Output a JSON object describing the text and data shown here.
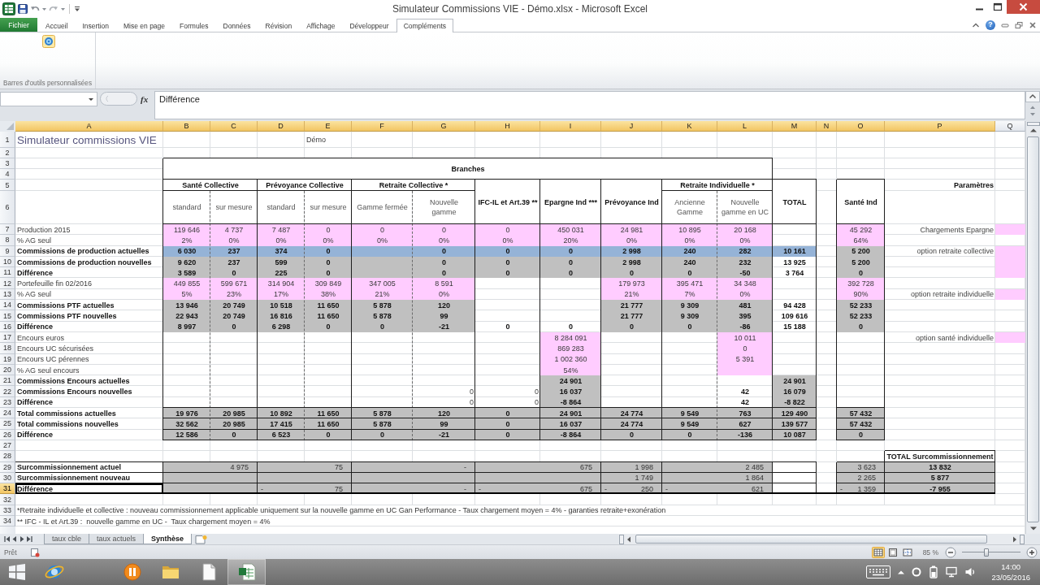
{
  "window": {
    "title": "Simulateur Commissions VIE - Démo.xlsx - Microsoft Excel"
  },
  "ribbon": {
    "file_tab": "Fichier",
    "tabs": [
      {
        "label": "Accueil",
        "selected": false
      },
      {
        "label": "Insertion",
        "selected": false
      },
      {
        "label": "Mise en page",
        "selected": false
      },
      {
        "label": "Formules",
        "selected": false
      },
      {
        "label": "Données",
        "selected": false
      },
      {
        "label": "Révision",
        "selected": false
      },
      {
        "label": "Affichage",
        "selected": false
      },
      {
        "label": "Développeur",
        "selected": false
      },
      {
        "label": "Compléments",
        "selected": true
      }
    ],
    "help": "?",
    "groups": [
      {
        "label": "Barres d'outils personnalisées"
      }
    ]
  },
  "formula_bar": {
    "function_label": "fx",
    "value": "Différence"
  },
  "sheet": {
    "columns": [
      {
        "label": "A",
        "selected": true
      },
      {
        "label": "B",
        "selected": true
      },
      {
        "label": "C",
        "selected": true
      },
      {
        "label": "D",
        "selected": true
      },
      {
        "label": "E",
        "selected": true
      },
      {
        "label": "F",
        "selected": true
      },
      {
        "label": "G",
        "selected": true
      },
      {
        "label": "H",
        "selected": true
      },
      {
        "label": "I",
        "selected": true
      },
      {
        "label": "J",
        "selected": true
      },
      {
        "label": "K",
        "selected": true
      },
      {
        "label": "L",
        "selected": true
      },
      {
        "label": "M",
        "selected": true
      },
      {
        "label": "N",
        "selected": true
      },
      {
        "label": "O",
        "selected": true
      },
      {
        "label": "P",
        "selected": true
      },
      {
        "label": "Q",
        "selected": false
      }
    ],
    "rows": [
      {
        "label": "1",
        "selected": false,
        "cells": {
          "A": {
            "kind": "title",
            "text": "Simulateur commissions VIE"
          },
          "E": {
            "kind": "label",
            "text": "Démo"
          }
        }
      },
      {
        "label": "2",
        "selected": false
      },
      {
        "label": "3",
        "selected": false,
        "cells": {
          "B": {
            "kind": "heading",
            "text": "Branches"
          },
          "C": {
            "kind": "mergeleft"
          },
          "D": {
            "kind": "mergeleft"
          },
          "E": {
            "kind": "mergeleft"
          },
          "F": {
            "kind": "mergeleft"
          },
          "G": {
            "kind": "mergeleft"
          },
          "H": {
            "kind": "mergeleft"
          },
          "I": {
            "kind": "mergeleft"
          },
          "J": {
            "kind": "mergeleft"
          },
          "K": {
            "kind": "mergeleft"
          },
          "L": {
            "kind": "mergeleft"
          }
        }
      },
      {
        "label": "4",
        "selected": false,
        "cells": {
          "B": {
            "kind": "mergeup"
          },
          "C": {
            "kind": "mergeup"
          },
          "D": {
            "kind": "mergeup"
          },
          "E": {
            "kind": "mergeup"
          },
          "F": {
            "kind": "mergeup"
          },
          "G": {
            "kind": "mergeup"
          },
          "H": {
            "kind": "mergeup"
          },
          "I": {
            "kind": "mergeup"
          },
          "J": {
            "kind": "mergeup"
          },
          "K": {
            "kind": "mergeup"
          },
          "L": {
            "kind": "mergeup"
          }
        }
      },
      {
        "label": "5",
        "selected": false,
        "cells": {
          "B": {
            "kind": "heading",
            "text": "Santé Collective"
          },
          "C": {
            "kind": "mergeleft"
          },
          "D": {
            "kind": "heading",
            "text": "Prévoyance Collective"
          },
          "E": {
            "kind": "mergeleft"
          },
          "F": {
            "kind": "heading",
            "text": "Retraite Collective *"
          },
          "G": {
            "kind": "mergeleft"
          },
          "H": {
            "kind": "heading",
            "text": "IFC-IL et Art.39 **"
          },
          "I": {
            "kind": "heading",
            "text": "Epargne Ind ***"
          },
          "J": {
            "kind": "heading",
            "text": "Prévoyance Ind"
          },
          "K": {
            "kind": "heading",
            "text": "Retraite Individuelle *"
          },
          "L": {
            "kind": "mergeleft"
          },
          "M": {
            "kind": "heading",
            "text": "TOTAL"
          },
          "O": {
            "kind": "heading",
            "text": "Santé Ind"
          },
          "P": {
            "kind": "sideheading",
            "text": "Paramètres"
          }
        }
      },
      {
        "label": "6",
        "selected": false,
        "cells": {
          "B": {
            "kind": "caption",
            "text": "standard"
          },
          "C": {
            "kind": "caption",
            "text": "sur mesure"
          },
          "D": {
            "kind": "caption",
            "text": "standard"
          },
          "E": {
            "kind": "caption",
            "text": "sur mesure"
          },
          "F": {
            "kind": "caption",
            "text": "Gamme fermée"
          },
          "G": {
            "kind": "caption",
            "text": "Nouvelle gamme"
          },
          "H": {
            "kind": "mergeup"
          },
          "I": {
            "kind": "mergeup"
          },
          "J": {
            "kind": "mergeup"
          },
          "K": {
            "kind": "caption",
            "text": "Ancienne Gamme"
          },
          "L": {
            "kind": "caption",
            "text": "Nouvelle gamme en UC"
          },
          "M": {
            "kind": "mergeup"
          },
          "O": {
            "kind": "mergeup"
          }
        }
      },
      {
        "label": "7",
        "selected": false,
        "cells": {
          "A": {
            "kind": "label",
            "text": "Production 2015"
          },
          "B": {
            "kind": "input",
            "text": "119 646"
          },
          "C": {
            "kind": "input",
            "text": "4 737"
          },
          "D": {
            "kind": "input",
            "text": "7 487"
          },
          "E": {
            "kind": "input",
            "text": "0"
          },
          "F": {
            "kind": "input",
            "text": "0"
          },
          "G": {
            "kind": "input",
            "text": "0"
          },
          "H": {
            "kind": "input",
            "text": "0"
          },
          "I": {
            "kind": "input",
            "text": "450 031"
          },
          "J": {
            "kind": "input",
            "text": "24 981"
          },
          "K": {
            "kind": "input",
            "text": "10 895"
          },
          "L": {
            "kind": "input",
            "text": "20 168"
          },
          "O": {
            "kind": "input",
            "text": "45 292"
          },
          "P": {
            "kind": "option",
            "text": "Chargements Epargne"
          },
          "Q": {
            "kind": "input"
          }
        }
      },
      {
        "label": "8",
        "selected": false,
        "cells": {
          "A": {
            "kind": "label",
            "text": "% AG seul"
          },
          "B": {
            "kind": "input",
            "text": "2%"
          },
          "C": {
            "kind": "input",
            "text": "0%"
          },
          "D": {
            "kind": "input",
            "text": "0%"
          },
          "E": {
            "kind": "input",
            "text": "0%"
          },
          "F": {
            "kind": "input",
            "text": "0%"
          },
          "G": {
            "kind": "input",
            "text": "0%"
          },
          "H": {
            "kind": "input",
            "text": "0%"
          },
          "I": {
            "kind": "input",
            "text": "20%"
          },
          "J": {
            "kind": "input",
            "text": "0%"
          },
          "K": {
            "kind": "input",
            "text": "0%"
          },
          "L": {
            "kind": "input",
            "text": "0%"
          },
          "O": {
            "kind": "input",
            "text": "64%"
          }
        }
      },
      {
        "label": "9",
        "selected": false,
        "cells": {
          "A": {
            "kind": "boldlabel",
            "text": "Commissions de production actuelles"
          },
          "B": {
            "kind": "highlight",
            "text": "6 030"
          },
          "C": {
            "kind": "highlight",
            "text": "237"
          },
          "D": {
            "kind": "highlight",
            "text": "374"
          },
          "E": {
            "kind": "highlight",
            "text": "0"
          },
          "F": {
            "kind": "highlight"
          },
          "G": {
            "kind": "highlight",
            "text": "0"
          },
          "H": {
            "kind": "highlight",
            "text": "0"
          },
          "I": {
            "kind": "highlight",
            "text": "0"
          },
          "J": {
            "kind": "highlight",
            "text": "2 998"
          },
          "K": {
            "kind": "highlight",
            "text": "240"
          },
          "L": {
            "kind": "highlight",
            "text": "282"
          },
          "M": {
            "kind": "highlight",
            "text": "10 161"
          },
          "O": {
            "kind": "computed",
            "text": "5 200"
          },
          "P": {
            "kind": "option",
            "text": "option retraite collective"
          },
          "Q": {
            "kind": "input"
          }
        }
      },
      {
        "label": "10",
        "selected": false,
        "cells": {
          "A": {
            "kind": "boldlabel",
            "text": "Commissions de production nouvelles"
          },
          "B": {
            "kind": "computed",
            "text": "9 620"
          },
          "C": {
            "kind": "computed",
            "text": "237"
          },
          "D": {
            "kind": "computed",
            "text": "599"
          },
          "E": {
            "kind": "computed",
            "text": "0"
          },
          "F": {
            "kind": "computed"
          },
          "G": {
            "kind": "computed",
            "text": "0"
          },
          "H": {
            "kind": "computed",
            "text": "0"
          },
          "I": {
            "kind": "computed",
            "text": "0"
          },
          "J": {
            "kind": "computed",
            "text": "2 998"
          },
          "K": {
            "kind": "computed",
            "text": "240"
          },
          "L": {
            "kind": "computed",
            "text": "232"
          },
          "M": {
            "kind": "total",
            "text": "13 925"
          },
          "O": {
            "kind": "computed",
            "text": "5 200"
          },
          "Q": {
            "kind": "mergeup"
          }
        }
      },
      {
        "label": "11",
        "selected": false,
        "cells": {
          "A": {
            "kind": "boldlabel",
            "text": "Différence"
          },
          "B": {
            "kind": "computed",
            "text": "3 589"
          },
          "C": {
            "kind": "computed",
            "text": "0"
          },
          "D": {
            "kind": "computed",
            "text": "225"
          },
          "E": {
            "kind": "computed",
            "text": "0"
          },
          "F": {
            "kind": "computed"
          },
          "G": {
            "kind": "computed",
            "text": "0"
          },
          "H": {
            "kind": "computed",
            "text": "0"
          },
          "I": {
            "kind": "computed",
            "text": "0"
          },
          "J": {
            "kind": "computed",
            "text": "0"
          },
          "K": {
            "kind": "computed",
            "text": "0"
          },
          "L": {
            "kind": "computed",
            "text": "-50"
          },
          "M": {
            "kind": "total",
            "text": "3 764"
          },
          "O": {
            "kind": "computed",
            "text": "0"
          },
          "Q": {
            "kind": "mergeup"
          }
        }
      },
      {
        "label": "12",
        "selected": false,
        "cells": {
          "A": {
            "kind": "label",
            "text": "Portefeuille fin 02/2016"
          },
          "B": {
            "kind": "input",
            "text": "449 855"
          },
          "C": {
            "kind": "input",
            "text": "599 671"
          },
          "D": {
            "kind": "input",
            "text": "314 904"
          },
          "E": {
            "kind": "input",
            "text": "309 849"
          },
          "F": {
            "kind": "input",
            "text": "347 005"
          },
          "G": {
            "kind": "input",
            "text": "8 591"
          },
          "J": {
            "kind": "input",
            "text": "179 973"
          },
          "K": {
            "kind": "input",
            "text": "395 471"
          },
          "L": {
            "kind": "input",
            "text": "34 348"
          },
          "O": {
            "kind": "input",
            "text": "392 728"
          }
        }
      },
      {
        "label": "13",
        "selected": false,
        "cells": {
          "A": {
            "kind": "label",
            "text": "% AG seul"
          },
          "B": {
            "kind": "input",
            "text": "5%"
          },
          "C": {
            "kind": "input",
            "text": "23%"
          },
          "D": {
            "kind": "input",
            "text": "17%"
          },
          "E": {
            "kind": "input",
            "text": "38%"
          },
          "F": {
            "kind": "input",
            "text": "21%"
          },
          "G": {
            "kind": "input",
            "text": "0%"
          },
          "J": {
            "kind": "input",
            "text": "21%"
          },
          "K": {
            "kind": "input",
            "text": "7%"
          },
          "L": {
            "kind": "input",
            "text": "0%"
          },
          "O": {
            "kind": "input",
            "text": "90%"
          },
          "P": {
            "kind": "option",
            "text": "option retraite individuelle"
          },
          "Q": {
            "kind": "input"
          }
        }
      },
      {
        "label": "14",
        "selected": false,
        "cells": {
          "A": {
            "kind": "boldlabel",
            "text": "Commissions PTF actuelles"
          },
          "B": {
            "kind": "computed",
            "text": "13 946"
          },
          "C": {
            "kind": "computed",
            "text": "20 749"
          },
          "D": {
            "kind": "computed",
            "text": "10 518"
          },
          "E": {
            "kind": "computed",
            "text": "11 650"
          },
          "F": {
            "kind": "computed",
            "text": "5 878"
          },
          "G": {
            "kind": "computed",
            "text": "120"
          },
          "J": {
            "kind": "computed",
            "text": "21 777"
          },
          "K": {
            "kind": "computed",
            "text": "9 309"
          },
          "L": {
            "kind": "computed",
            "text": "481"
          },
          "M": {
            "kind": "total",
            "text": "94 428"
          },
          "O": {
            "kind": "computed",
            "text": "52 233"
          }
        }
      },
      {
        "label": "15",
        "selected": false,
        "cells": {
          "A": {
            "kind": "boldlabel",
            "text": "Commissions PTF nouvelles"
          },
          "B": {
            "kind": "computed",
            "text": "22 943"
          },
          "C": {
            "kind": "computed",
            "text": "20 749"
          },
          "D": {
            "kind": "computed",
            "text": "16 816"
          },
          "E": {
            "kind": "computed",
            "text": "11 650"
          },
          "F": {
            "kind": "computed",
            "text": "5 878"
          },
          "G": {
            "kind": "computed",
            "text": "99"
          },
          "J": {
            "kind": "computed",
            "text": "21 777"
          },
          "K": {
            "kind": "computed",
            "text": "9 309"
          },
          "L": {
            "kind": "computed",
            "text": "395"
          },
          "M": {
            "kind": "total",
            "text": "109 616"
          },
          "O": {
            "kind": "computed",
            "text": "52 233"
          }
        }
      },
      {
        "label": "16",
        "selected": false,
        "cells": {
          "A": {
            "kind": "boldlabel",
            "text": "Différence"
          },
          "B": {
            "kind": "computed",
            "text": "8 997"
          },
          "C": {
            "kind": "computed",
            "text": "0"
          },
          "D": {
            "kind": "computed",
            "text": "6 298"
          },
          "E": {
            "kind": "computed",
            "text": "0"
          },
          "F": {
            "kind": "computed",
            "text": "0"
          },
          "G": {
            "kind": "computed",
            "text": "-21"
          },
          "H": {
            "kind": "total",
            "text": "0"
          },
          "I": {
            "kind": "total",
            "text": "0"
          },
          "J": {
            "kind": "computed",
            "text": "0"
          },
          "K": {
            "kind": "computed",
            "text": "0"
          },
          "L": {
            "kind": "computed",
            "text": "-86"
          },
          "M": {
            "kind": "total",
            "text": "15 188"
          },
          "O": {
            "kind": "computed",
            "text": "0"
          }
        }
      },
      {
        "label": "17",
        "selected": false,
        "cells": {
          "A": {
            "kind": "label",
            "text": "Encours euros"
          },
          "I": {
            "kind": "input",
            "text": "8 284 091"
          },
          "L": {
            "kind": "input",
            "text": "10 011"
          },
          "P": {
            "kind": "option",
            "text": "option santé individuelle"
          },
          "Q": {
            "kind": "input"
          }
        }
      },
      {
        "label": "18",
        "selected": false,
        "cells": {
          "A": {
            "kind": "label",
            "text": "Encours UC sécurisées"
          },
          "I": {
            "kind": "input",
            "text": "869 283"
          },
          "L": {
            "kind": "input",
            "text": "0"
          }
        }
      },
      {
        "label": "19",
        "selected": false,
        "cells": {
          "A": {
            "kind": "label",
            "text": "Encours UC pérennes"
          },
          "I": {
            "kind": "input",
            "text": "1 002 360"
          },
          "L": {
            "kind": "input",
            "text": "5 391"
          }
        }
      },
      {
        "label": "20",
        "selected": false,
        "cells": {
          "A": {
            "kind": "label",
            "text": "% AG seul encours"
          },
          "I": {
            "kind": "input",
            "text": "54%"
          },
          "L": {
            "kind": "input"
          }
        }
      },
      {
        "label": "21",
        "selected": false,
        "cells": {
          "A": {
            "kind": "boldlabel",
            "text": "Commissions Encours actuelles"
          },
          "I": {
            "kind": "computed",
            "text": "24 901"
          },
          "M": {
            "kind": "computed",
            "text": "24 901"
          }
        }
      },
      {
        "label": "22",
        "selected": false,
        "cells": {
          "A": {
            "kind": "boldlabel",
            "text": "Commissions Encours nouvelles"
          },
          "G": {
            "kind": "general",
            "text": "0"
          },
          "H": {
            "kind": "general",
            "text": "0"
          },
          "I": {
            "kind": "computed",
            "text": "16 037"
          },
          "L": {
            "kind": "total",
            "text": "42"
          },
          "M": {
            "kind": "computed",
            "text": "16 079"
          }
        }
      },
      {
        "label": "23",
        "selected": false,
        "cells": {
          "A": {
            "kind": "boldlabel",
            "text": "Différence"
          },
          "G": {
            "kind": "general",
            "text": "0"
          },
          "H": {
            "kind": "general",
            "text": "0"
          },
          "I": {
            "kind": "computed",
            "text": "-8 864"
          },
          "L": {
            "kind": "total",
            "text": "42"
          },
          "M": {
            "kind": "computed",
            "text": "-8 822"
          }
        }
      },
      {
        "label": "24",
        "selected": false,
        "cells": {
          "A": {
            "kind": "boldlabel",
            "text": "Total commissions actuelles"
          },
          "B": {
            "kind": "computed",
            "text": "19 976"
          },
          "C": {
            "kind": "computed",
            "text": "20 985"
          },
          "D": {
            "kind": "computed",
            "text": "10 892"
          },
          "E": {
            "kind": "computed",
            "text": "11 650"
          },
          "F": {
            "kind": "computed",
            "text": "5 878"
          },
          "G": {
            "kind": "computed",
            "text": "120"
          },
          "H": {
            "kind": "computed",
            "text": "0"
          },
          "I": {
            "kind": "computed",
            "text": "24 901"
          },
          "J": {
            "kind": "computed",
            "text": "24 774"
          },
          "K": {
            "kind": "computed",
            "text": "9 549"
          },
          "L": {
            "kind": "computed",
            "text": "763"
          },
          "M": {
            "kind": "computed",
            "text": "129 490"
          },
          "O": {
            "kind": "computed",
            "text": "57 432"
          }
        }
      },
      {
        "label": "25",
        "selected": false,
        "cells": {
          "A": {
            "kind": "boldlabel",
            "text": "Total commissions nouvelles"
          },
          "B": {
            "kind": "computed",
            "text": "32 562"
          },
          "C": {
            "kind": "computed",
            "text": "20 985"
          },
          "D": {
            "kind": "computed",
            "text": "17 415"
          },
          "E": {
            "kind": "computed",
            "text": "11 650"
          },
          "F": {
            "kind": "computed",
            "text": "5 878"
          },
          "G": {
            "kind": "computed",
            "text": "99"
          },
          "H": {
            "kind": "computed",
            "text": "0"
          },
          "I": {
            "kind": "computed",
            "text": "16 037"
          },
          "J": {
            "kind": "computed",
            "text": "24 774"
          },
          "K": {
            "kind": "computed",
            "text": "9 549"
          },
          "L": {
            "kind": "computed",
            "text": "627"
          },
          "M": {
            "kind": "computed",
            "text": "139 577"
          },
          "O": {
            "kind": "computed",
            "text": "57 432"
          }
        }
      },
      {
        "label": "26",
        "selected": false,
        "cells": {
          "A": {
            "kind": "boldlabel",
            "text": "Différence"
          },
          "B": {
            "kind": "computed",
            "text": "12 586"
          },
          "C": {
            "kind": "computed",
            "text": "0"
          },
          "D": {
            "kind": "computed",
            "text": "6 523"
          },
          "E": {
            "kind": "computed",
            "text": "0"
          },
          "F": {
            "kind": "computed",
            "text": "0"
          },
          "G": {
            "kind": "computed",
            "text": "-21"
          },
          "H": {
            "kind": "computed",
            "text": "0"
          },
          "I": {
            "kind": "computed",
            "text": "-8 864"
          },
          "J": {
            "kind": "computed",
            "text": "0"
          },
          "K": {
            "kind": "computed",
            "text": "0"
          },
          "L": {
            "kind": "computed",
            "text": "-136"
          },
          "M": {
            "kind": "computed",
            "text": "10 087"
          },
          "O": {
            "kind": "computed",
            "text": "0"
          }
        }
      },
      {
        "label": "27",
        "selected": false
      },
      {
        "label": "28",
        "selected": false,
        "cells": {
          "P": {
            "kind": "heading",
            "text": "TOTAL Surcommissionnement"
          }
        }
      },
      {
        "label": "29",
        "selected": false,
        "cells": {
          "A": {
            "kind": "boldlabel",
            "text": "Surcommissionnement actuel"
          },
          "B": {
            "kind": "amount",
            "text": "4 975"
          },
          "C": {
            "kind": "mergeleft"
          },
          "D": {
            "kind": "amount",
            "text": "75"
          },
          "E": {
            "kind": "mergeleft"
          },
          "F": {
            "kind": "amount",
            "text": "-"
          },
          "G": {
            "kind": "mergeleft"
          },
          "H": {
            "kind": "amount",
            "text": "675"
          },
          "I": {
            "kind": "mergeleft"
          },
          "J": {
            "kind": "amount",
            "text": "1 998"
          },
          "K": {
            "kind": "amount",
            "text": "2 485"
          },
          "L": {
            "kind": "mergeleft"
          },
          "O": {
            "kind": "amount",
            "text": "3 623"
          },
          "P": {
            "kind": "computed",
            "text": "13 832"
          }
        }
      },
      {
        "label": "30",
        "selected": false,
        "cells": {
          "A": {
            "kind": "boldlabel",
            "text": "Surcommissionnement nouveau"
          },
          "B": {
            "kind": "amount"
          },
          "C": {
            "kind": "mergeleft"
          },
          "D": {
            "kind": "amount"
          },
          "E": {
            "kind": "mergeleft"
          },
          "F": {
            "kind": "amount"
          },
          "G": {
            "kind": "mergeleft"
          },
          "H": {
            "kind": "amount"
          },
          "I": {
            "kind": "mergeleft"
          },
          "J": {
            "kind": "amount",
            "text": "1 749"
          },
          "K": {
            "kind": "amount",
            "text": "1 864"
          },
          "L": {
            "kind": "mergeleft"
          },
          "O": {
            "kind": "amount",
            "text": "2 265"
          },
          "P": {
            "kind": "computed",
            "text": "5 877"
          }
        }
      },
      {
        "label": "31",
        "selected": true,
        "cells": {
          "A": {
            "kind": "boldlabel",
            "text": "Différence"
          },
          "B": {
            "kind": "amount"
          },
          "C": {
            "kind": "mergeleft"
          },
          "D": {
            "kind": "amount",
            "sign": "-",
            "text": "75"
          },
          "E": {
            "kind": "mergeleft"
          },
          "F": {
            "kind": "amount",
            "text": "-"
          },
          "G": {
            "kind": "mergeleft"
          },
          "H": {
            "kind": "amount",
            "sign": "-",
            "text": "675"
          },
          "I": {
            "kind": "mergeleft"
          },
          "J": {
            "kind": "amount",
            "sign": "-",
            "text": "250"
          },
          "K": {
            "kind": "amount",
            "sign": "-",
            "text": "621"
          },
          "L": {
            "kind": "mergeleft"
          },
          "O": {
            "kind": "amount",
            "sign": "-",
            "text": "1 359"
          },
          "P": {
            "kind": "computed",
            "text": "-7 955"
          }
        }
      },
      {
        "label": "32",
        "selected": false
      },
      {
        "label": "33",
        "selected": false,
        "cells": {
          "A": {
            "kind": "note",
            "text": "*Retraite individuelle et collective : nouveau commissionnement applicable uniquement sur la nouvelle gamme en UC Gan Performance - Taux chargement moyen = 4% - garanties retraite+exonération"
          }
        }
      },
      {
        "label": "34",
        "selected": false,
        "cells": {
          "A": {
            "kind": "note",
            "text": "** IFC - IL et Art.39 :  nouvelle gamme en UC -  Taux chargement moyen = 4%"
          }
        }
      }
    ]
  },
  "sheet_tabs": [
    {
      "label": "taux cble",
      "selected": false
    },
    {
      "label": "taux actuels",
      "selected": false
    },
    {
      "label": "Synthèse",
      "selected": true
    }
  ],
  "status_bar": {
    "status": "Prêt",
    "views": [
      {
        "kind": "normal",
        "selected": true
      },
      {
        "kind": "layout",
        "selected": false
      },
      {
        "kind": "pagebreak",
        "selected": false
      }
    ],
    "zoom": {
      "reading": "85 %",
      "level": 0.42
    }
  },
  "taskbar": {
    "apps": [
      {
        "kind": "start",
        "selected": false
      },
      {
        "kind": "browser",
        "selected": false
      },
      {
        "kind": "recorder",
        "selected": false
      },
      {
        "kind": "folder",
        "selected": false
      },
      {
        "kind": "document",
        "selected": false
      },
      {
        "kind": "spreadsheet",
        "selected": true
      }
    ],
    "time": "14:00",
    "date": "23/05/2016"
  }
}
